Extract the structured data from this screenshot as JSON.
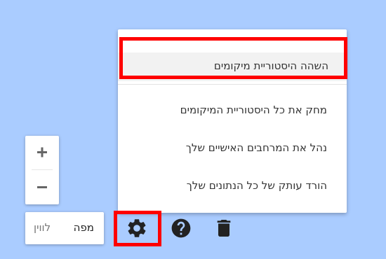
{
  "settings_menu": {
    "items": [
      {
        "label": "השהה היסטוריית מיקומים"
      },
      {
        "label": "מחק את כל היסטוריית המיקומים"
      },
      {
        "label": "נהל את המרחבים האישיים שלך"
      },
      {
        "label": "הורד עותק של כל הנתונים שלך"
      }
    ]
  },
  "zoom": {
    "in_icon": "plus-icon",
    "out_icon": "minus-icon"
  },
  "map_type": {
    "map_label": "מפה",
    "satellite_label": "לווין"
  },
  "toolbar": {
    "icons": [
      "gear-icon",
      "help-icon",
      "trash-icon"
    ]
  },
  "colors": {
    "map_background": "#aaccff",
    "highlight": "#ff0000",
    "icon": "#222222"
  }
}
